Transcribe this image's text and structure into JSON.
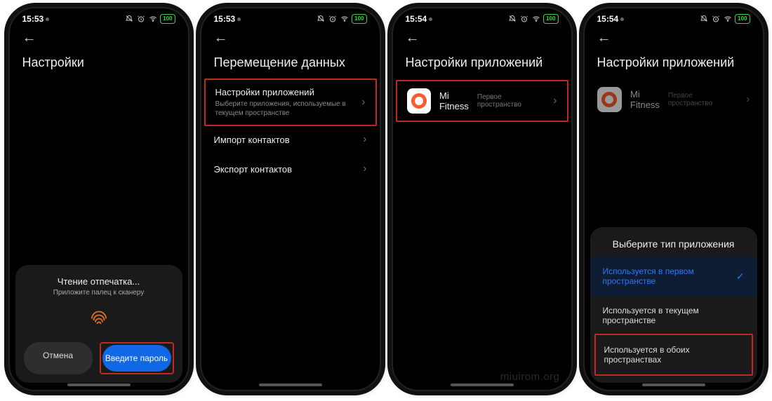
{
  "status": {
    "time1": "15:53",
    "time2": "15:53",
    "time3": "15:54",
    "time4": "15:54",
    "battery": "100"
  },
  "screen1": {
    "title": "Настройки",
    "sheet_title": "Чтение отпечатка...",
    "sheet_sub": "Приложите палец к сканеру",
    "cancel": "Отмена",
    "password": "Введите пароль"
  },
  "screen2": {
    "title": "Перемещение данных",
    "item1": "Настройки приложений",
    "item1_sub": "Выберите приложения, используемые в текущем пространстве",
    "item2": "Импорт контактов",
    "item3": "Экспорт контактов"
  },
  "screen3": {
    "title": "Настройки приложений",
    "app": "Mi Fitness",
    "meta": "Первое пространство",
    "watermark": "miuirom.org"
  },
  "screen4": {
    "title": "Настройки приложений",
    "app": "Mi Fitness",
    "meta": "Первое пространство",
    "sheet_title": "Выберите тип приложения",
    "opt1": "Используется в первом пространстве",
    "opt2": "Используется в текущем пространстве",
    "opt3": "Используется в обоих пространствах"
  }
}
